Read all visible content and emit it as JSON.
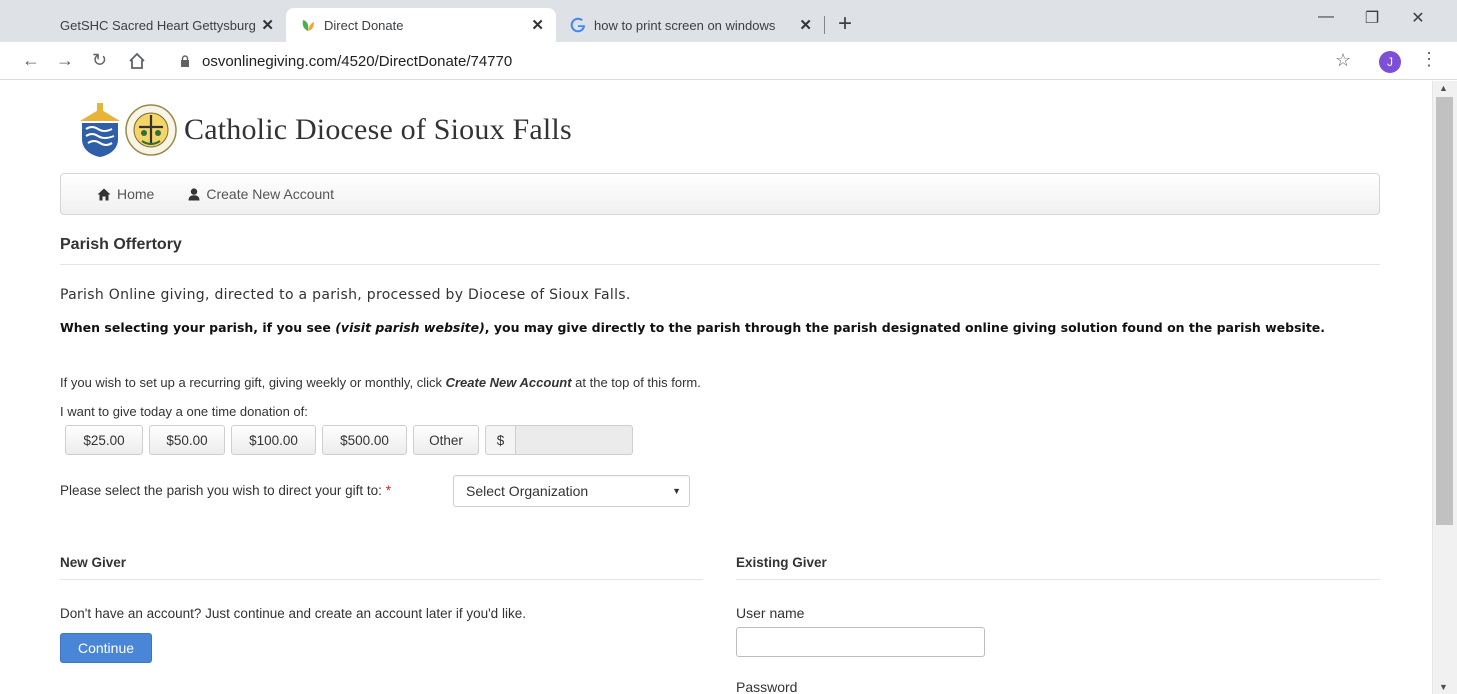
{
  "browser": {
    "tabs": [
      {
        "title": "GetSHC Sacred Heart Gettysburg",
        "close": "✕",
        "active": false
      },
      {
        "title": "Direct Donate",
        "close": "✕",
        "active": true
      },
      {
        "title": "how to print screen on windows",
        "close": "✕",
        "active": false
      }
    ],
    "new_tab": "+",
    "url": "osvonlinegiving.com/4520/DirectDonate/74770",
    "avatar_initial": "J",
    "window_controls": {
      "minimize": "—",
      "restore": "❐",
      "close": "✕"
    }
  },
  "site": {
    "title": "Catholic Diocese of Sioux Falls",
    "nav": [
      {
        "label": "Home",
        "icon": "home-icon"
      },
      {
        "label": "Create New Account",
        "icon": "user-icon"
      }
    ]
  },
  "form": {
    "section_title": "Parish Offertory",
    "intro": "Parish Online giving, directed to a parish, processed by Diocese of Sioux Falls.",
    "notice_prefix": "When selecting your parish, if you see ",
    "notice_emph": "(visit parish website)",
    "notice_suffix": ", you may give directly to the parish through the parish designated online giving solution found on the parish website.",
    "recurring_prefix": "If you wish to set up a recurring gift, giving weekly or monthly, click ",
    "recurring_emph": "Create New Account",
    "recurring_suffix": " at the top of this form.",
    "give_label": "I want to give today a one time donation of:",
    "amounts": [
      "$25.00",
      "$50.00",
      "$100.00",
      "$500.00",
      "Other"
    ],
    "currency_symbol": "$",
    "amount_value": "",
    "parish_label": "Please select the parish you wish to direct your gift to:",
    "required_mark": "*",
    "org_select": "Select Organization"
  },
  "new_giver": {
    "title": "New Giver",
    "text": "Don't have an account? Just continue and create an account later if you'd like.",
    "continue_label": "Continue"
  },
  "existing_giver": {
    "title": "Existing Giver",
    "username_label": "User name",
    "password_label": "Password",
    "username_value": ""
  },
  "colors": {
    "primary_button": "#4a86d8",
    "required": "#e02020",
    "tab_strip": "#dee1e6"
  }
}
